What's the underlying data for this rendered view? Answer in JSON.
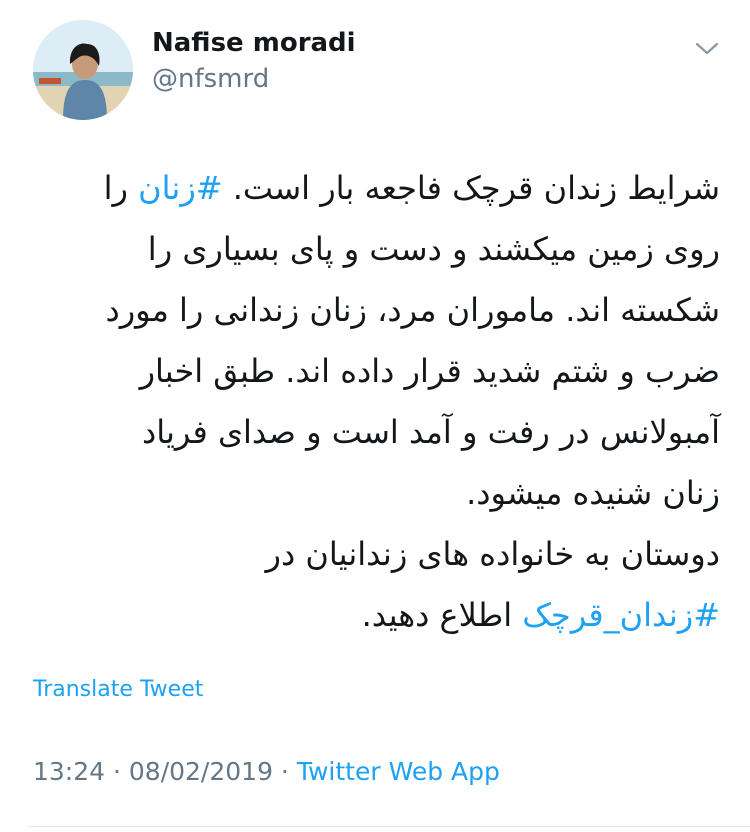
{
  "user": {
    "display_name": "Nafise moradi",
    "handle": "@nfsmrd",
    "avatar_icon": "profile-photo"
  },
  "tweet": {
    "lines": [
      {
        "before": "شرایط زندان قرچک فاجعه بار است. ",
        "hashtag": "#زنان",
        "after": " را"
      },
      {
        "text": "روی زمین میکشند و دست و پای بسیاری را"
      },
      {
        "text": "شکسته اند. ماموران مرد، زنان زندانی را مورد"
      },
      {
        "text": "ضرب و شتم شدید قرار داده اند. طبق اخبار"
      },
      {
        "text": "آمبولانس در رفت و آمد است و صدای فریاد"
      },
      {
        "text": "زنان شنیده میشود."
      },
      {
        "text": "دوستان به خانواده های زندانیان در"
      },
      {
        "hashtag": "#زندان_قرچک",
        "after": " اطلاع دهید."
      }
    ]
  },
  "translate_label": "Translate Tweet",
  "meta": {
    "time": "13:24",
    "separator": " · ",
    "date": "08/02/2019",
    "source": "Twitter Web App"
  },
  "colors": {
    "link": "#1da1f2",
    "secondary_text": "#657786",
    "primary_text": "#14171a"
  }
}
